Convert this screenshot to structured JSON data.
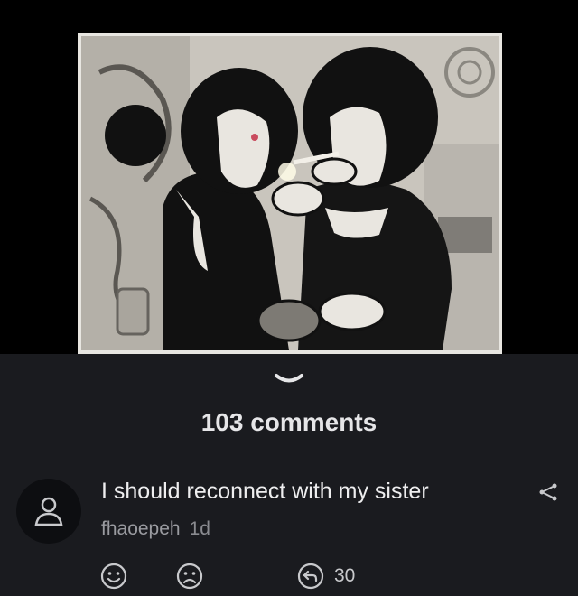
{
  "comments_header": {
    "count_label": "103 comments"
  },
  "comment": {
    "text": "I should reconnect with my sister",
    "author": "fhaoepeh",
    "time": "1d",
    "reply_count": "30"
  },
  "colors": {
    "background": "#1a1b1f",
    "text_primary": "#e6e6e8",
    "text_secondary": "#9a9ba0",
    "icon": "#c8c9cc"
  },
  "icons": {
    "collapse": "chevron-down-icon",
    "avatar": "user-icon",
    "share": "share-icon",
    "like": "smile-icon",
    "dislike": "frown-icon",
    "reply": "reply-icon"
  }
}
